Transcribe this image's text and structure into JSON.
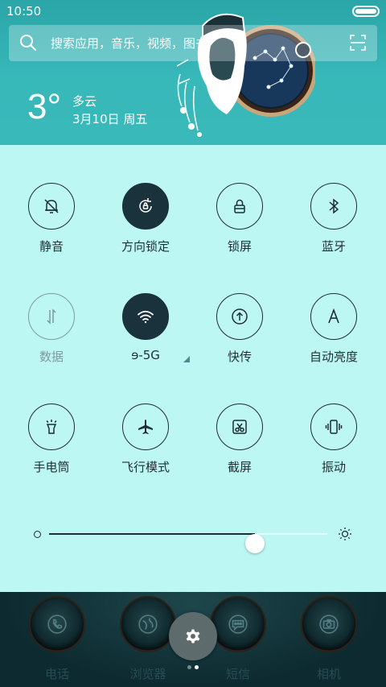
{
  "status_bar": {
    "time": "10:50"
  },
  "search": {
    "placeholder": "搜索应用，音乐，视频，图书"
  },
  "weather": {
    "temperature": "3°",
    "condition": "多云",
    "date": "3月10日 周五"
  },
  "toggles": [
    {
      "id": "mute",
      "label": "静音",
      "icon": "bell-off-icon",
      "active": false,
      "enabled": true
    },
    {
      "id": "rotation-lock",
      "label": "方向锁定",
      "icon": "rotation-lock-icon",
      "active": true,
      "enabled": true
    },
    {
      "id": "lock-screen",
      "label": "锁屏",
      "icon": "lock-icon",
      "active": false,
      "enabled": true
    },
    {
      "id": "bluetooth",
      "label": "蓝牙",
      "icon": "bluetooth-icon",
      "active": false,
      "enabled": true
    },
    {
      "id": "data",
      "label": "数据",
      "icon": "data-arrows-icon",
      "active": false,
      "enabled": false
    },
    {
      "id": "wifi",
      "label": "ɘ-5G",
      "icon": "wifi-icon",
      "active": true,
      "enabled": true
    },
    {
      "id": "share",
      "label": "快传",
      "icon": "upload-icon",
      "active": false,
      "enabled": true
    },
    {
      "id": "auto-brightness",
      "label": "自动亮度",
      "icon": "letter-a-icon",
      "active": false,
      "enabled": true
    },
    {
      "id": "flashlight",
      "label": "手电筒",
      "icon": "flashlight-icon",
      "active": false,
      "enabled": true
    },
    {
      "id": "airplane",
      "label": "飞行模式",
      "icon": "airplane-icon",
      "active": false,
      "enabled": true
    },
    {
      "id": "screenshot",
      "label": "截屏",
      "icon": "scissors-icon",
      "active": false,
      "enabled": true
    },
    {
      "id": "vibrate",
      "label": "振动",
      "icon": "vibrate-icon",
      "active": false,
      "enabled": true
    }
  ],
  "brightness": {
    "level": 0.74
  },
  "dock": {
    "apps": [
      {
        "label": "电话",
        "icon": "phone-icon"
      },
      {
        "label": "浏览器",
        "icon": "globe-icon"
      },
      {
        "label": "短信",
        "icon": "chat-icon"
      },
      {
        "label": "相机",
        "icon": "camera-icon"
      }
    ],
    "settings_icon": "gear-icon",
    "page_count": 2,
    "current_page": 2
  },
  "colors": {
    "header": "#37b8b9",
    "panel": "#bdf7f4",
    "active_toggle": "#19323b",
    "dock": "#0d2a30"
  }
}
